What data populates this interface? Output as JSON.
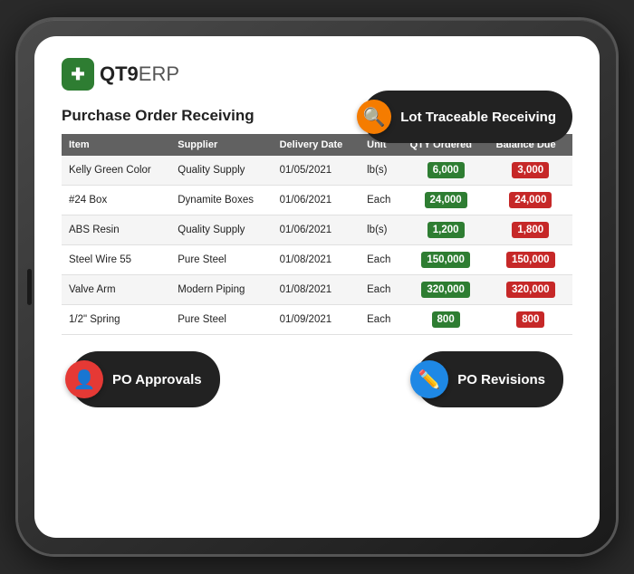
{
  "app": {
    "logo_text": "QT9",
    "logo_suffix": "ERP"
  },
  "lot_badge": {
    "label": "Lot Traceable Receiving"
  },
  "page": {
    "title": "Purchase Order Receiving"
  },
  "table": {
    "headers": [
      "Item",
      "Supplier",
      "Delivery Date",
      "Unit",
      "QTY Ordered",
      "Balance Due"
    ],
    "rows": [
      {
        "item": "Kelly Green Color",
        "supplier": "Quality Supply",
        "delivery": "01/05/2021",
        "unit": "lb(s)",
        "qty": "6,000",
        "balance": "3,000",
        "qty_color": "green",
        "balance_color": "red"
      },
      {
        "item": "#24 Box",
        "supplier": "Dynamite Boxes",
        "delivery": "01/06/2021",
        "unit": "Each",
        "qty": "24,000",
        "balance": "24,000",
        "qty_color": "green",
        "balance_color": "red"
      },
      {
        "item": "ABS Resin",
        "supplier": "Quality Supply",
        "delivery": "01/06/2021",
        "unit": "lb(s)",
        "qty": "1,200",
        "balance": "1,800",
        "qty_color": "green",
        "balance_color": "red"
      },
      {
        "item": "Steel Wire 55",
        "supplier": "Pure Steel",
        "delivery": "01/08/2021",
        "unit": "Each",
        "qty": "150,000",
        "balance": "150,000",
        "qty_color": "green",
        "balance_color": "red"
      },
      {
        "item": "Valve Arm",
        "supplier": "Modern Piping",
        "delivery": "01/08/2021",
        "unit": "Each",
        "qty": "320,000",
        "balance": "320,000",
        "qty_color": "green",
        "balance_color": "red"
      },
      {
        "item": "1/2\" Spring",
        "supplier": "Pure Steel",
        "delivery": "01/09/2021",
        "unit": "Each",
        "qty": "800",
        "balance": "800",
        "qty_color": "green",
        "balance_color": "red"
      }
    ]
  },
  "bottom_badges": {
    "approvals_label": "PO Approvals",
    "revisions_label": "PO Revisions"
  }
}
